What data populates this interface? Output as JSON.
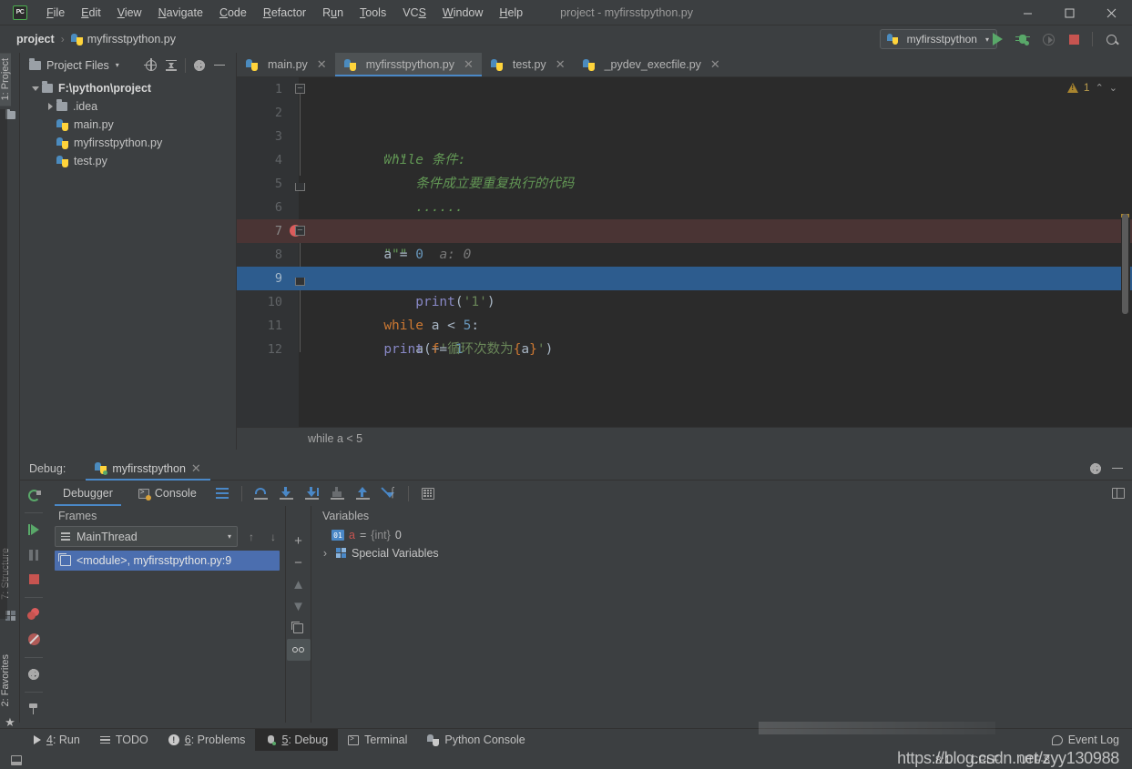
{
  "window": {
    "title": "project - myfirsstpython.py",
    "app_icon": "PC",
    "minimize": "—",
    "maximize": "☐",
    "close": "✕"
  },
  "menubar": [
    {
      "label": "File",
      "mnemonic": "F"
    },
    {
      "label": "Edit",
      "mnemonic": "E"
    },
    {
      "label": "View",
      "mnemonic": "V"
    },
    {
      "label": "Navigate",
      "mnemonic": "N"
    },
    {
      "label": "Code",
      "mnemonic": "C"
    },
    {
      "label": "Refactor",
      "mnemonic": "R"
    },
    {
      "label": "Run",
      "mnemonic": "u"
    },
    {
      "label": "Tools",
      "mnemonic": "T"
    },
    {
      "label": "VCS",
      "mnemonic": "S"
    },
    {
      "label": "Window",
      "mnemonic": "W"
    },
    {
      "label": "Help",
      "mnemonic": "H"
    }
  ],
  "navbar": {
    "project": "project",
    "separator": "›",
    "file": "myfirsstpython.py",
    "run_config": "myfirsstpython",
    "caret": "▾",
    "buttons": [
      "run-button",
      "debug-button",
      "coverage-button",
      "stop-button",
      "search-button"
    ]
  },
  "left_strip": {
    "top_tab": "1: Project",
    "structure_tab": "7: Structure",
    "favorites_tab": "2: Favorites"
  },
  "project_panel": {
    "title": "Project Files",
    "caret": "▾",
    "tools": [
      "locate-icon",
      "collapse-all-icon",
      "settings-icon",
      "hide-icon"
    ],
    "tree": [
      {
        "label": "F:\\python\\project",
        "depth": 0,
        "type": "folder",
        "expanded": true,
        "bold": true
      },
      {
        "label": ".idea",
        "depth": 1,
        "type": "folder",
        "expanded": false,
        "bold": false
      },
      {
        "label": "main.py",
        "depth": 1,
        "type": "python",
        "bold": false
      },
      {
        "label": "myfirsstpython.py",
        "depth": 1,
        "type": "python",
        "bold": false
      },
      {
        "label": "test.py",
        "depth": 1,
        "type": "python",
        "bold": false
      }
    ]
  },
  "editor": {
    "tabs": [
      {
        "label": "main.py",
        "active": false
      },
      {
        "label": "myfirsstpython.py",
        "active": true
      },
      {
        "label": "test.py",
        "active": false
      },
      {
        "label": "_pydev_execfile.py",
        "active": false
      }
    ],
    "close_glyph": "✕",
    "inspection": {
      "count": "1",
      "up": "⌃",
      "down": "⌄"
    },
    "breadcrumb": "while a < 5",
    "lines": [
      {
        "n": "1",
        "tokens": [
          {
            "t": "\"\"\"",
            "c": "k-doc"
          }
        ],
        "indent": 0,
        "fold": "start",
        "state": "normal"
      },
      {
        "n": "2",
        "tokens": [
          {
            "t": "while 条件:",
            "c": "k-doc"
          }
        ],
        "indent": 0,
        "state": "normal"
      },
      {
        "n": "3",
        "tokens": [
          {
            "t": "    条件成立要重复执行的代码",
            "c": "k-doc"
          }
        ],
        "indent": 0,
        "state": "normal"
      },
      {
        "n": "4",
        "tokens": [
          {
            "t": "    ......",
            "c": "k-doc"
          }
        ],
        "indent": 0,
        "state": "normal"
      },
      {
        "n": "5",
        "tokens": [
          {
            "t": "\"\"\"",
            "c": "k-doc"
          }
        ],
        "indent": 0,
        "fold": "end",
        "state": "normal"
      },
      {
        "n": "6",
        "tokens": [
          {
            "t": "a ",
            "c": "k-txt"
          },
          {
            "t": "= ",
            "c": "k-punc"
          },
          {
            "t": "0",
            "c": "k-num"
          },
          {
            "t": "  a: 0",
            "c": "k-hint"
          }
        ],
        "state": "normal"
      },
      {
        "n": "7",
        "tokens": [
          {
            "t": "while ",
            "c": "k-kw"
          },
          {
            "t": "a ",
            "c": "k-txt"
          },
          {
            "t": "< ",
            "c": "k-punc"
          },
          {
            "t": "5",
            "c": "k-num"
          },
          {
            "t": ":",
            "c": "k-punc"
          }
        ],
        "fold": "start",
        "state": "breakpoint"
      },
      {
        "n": "8",
        "tokens": [
          {
            "t": "    ",
            "c": "k-txt"
          },
          {
            "t": "print",
            "c": "k-fn"
          },
          {
            "t": "(",
            "c": "k-punc"
          },
          {
            "t": "'1'",
            "c": "k-str"
          },
          {
            "t": ")",
            "c": "k-punc"
          }
        ],
        "state": "normal"
      },
      {
        "n": "9",
        "tokens": [
          {
            "t": "    a ",
            "c": "k-txt"
          },
          {
            "t": "+= ",
            "c": "k-punc"
          },
          {
            "t": "1",
            "c": "k-num"
          }
        ],
        "fold": "end",
        "state": "current"
      },
      {
        "n": "10",
        "tokens": [
          {
            "t": "print",
            "c": "k-fn"
          },
          {
            "t": "(",
            "c": "k-punc"
          },
          {
            "t": "f",
            "c": "k-kw"
          },
          {
            "t": "'循环次数为",
            "c": "k-str"
          },
          {
            "t": "{",
            "c": "k-brace"
          },
          {
            "t": "a",
            "c": "k-txt"
          },
          {
            "t": "}",
            "c": "k-brace"
          },
          {
            "t": "'",
            "c": "k-str"
          },
          {
            "t": ")",
            "c": "k-punc"
          }
        ],
        "state": "normal"
      },
      {
        "n": "11",
        "tokens": [],
        "state": "normal"
      },
      {
        "n": "12",
        "tokens": [],
        "state": "normal"
      }
    ]
  },
  "debug": {
    "label": "Debug:",
    "session_tab": "myfirsstpython",
    "close_glyph": "✕",
    "tabs": [
      {
        "label": "Debugger",
        "selected": true
      },
      {
        "label": "Console",
        "selected": false
      }
    ],
    "toolbar_icons": [
      "step-over-icon",
      "step-into-icon",
      "force-step-into-icon",
      "step-into-my-code-icon",
      "step-out-icon",
      "run-to-cursor-icon",
      "evaluate-expression-icon"
    ],
    "side_icons": [
      "rerun-icon",
      "resume-program-icon",
      "pause-program-icon",
      "stop-icon",
      "view-breakpoints-icon",
      "mute-breakpoints-icon",
      "settings-icon",
      "pin-icon"
    ],
    "frames": {
      "header": "Frames",
      "thread": "MainThread",
      "thread_caret": "▾",
      "up_arrow": "↑",
      "down_arrow": "↓",
      "items": [
        {
          "label": "<module>, myfirsstpython.py:9",
          "selected": true
        }
      ]
    },
    "frame_buttons": [
      "add-button",
      "remove-button",
      "up-button",
      "down-button",
      "copy-button",
      "inspect-button"
    ],
    "variables": {
      "header": "Variables",
      "add_glyph": "+",
      "remove_glyph": "−",
      "items": [
        {
          "badge": "01",
          "name": "a",
          "eq": "=",
          "type": "{int}",
          "value": "0",
          "expandable": false
        },
        {
          "label": "Special Variables",
          "expandable": true,
          "chevron": "›"
        }
      ]
    }
  },
  "bottom_bar": {
    "items": [
      {
        "label": "4: Run",
        "mnemonic": "4",
        "icon": "run-icon",
        "selected": false
      },
      {
        "label": "TODO",
        "mnemonic": "",
        "icon": "todo-icon",
        "selected": false
      },
      {
        "label": "6: Problems",
        "mnemonic": "6",
        "icon": "problems-icon",
        "selected": false
      },
      {
        "label": "5: Debug",
        "mnemonic": "5",
        "icon": "debug-icon",
        "selected": true
      },
      {
        "label": "Terminal",
        "mnemonic": "",
        "icon": "terminal-icon",
        "selected": false
      },
      {
        "label": "Python Console",
        "mnemonic": "",
        "icon": "python-console-icon",
        "selected": false
      }
    ],
    "event_log": "Event Log"
  },
  "status_bar": {
    "caret_position": "8:1",
    "line_separator": "CRLF",
    "encoding": "UTF-8",
    "watermark": "https://blog.csdn.net/zyy130988"
  },
  "colors": {
    "accent": "#4a88c7",
    "editor_bg": "#2b2b2b",
    "panel_bg": "#3c3f41",
    "breakpoint": "#db5c5c",
    "current_line": "#2d5c8e",
    "keyword": "#cc7832",
    "string": "#6a8759",
    "docstring": "#629755",
    "number": "#6897bb",
    "function": "#8888c6",
    "run_green": "#59a869",
    "stop_red": "#c75450"
  }
}
